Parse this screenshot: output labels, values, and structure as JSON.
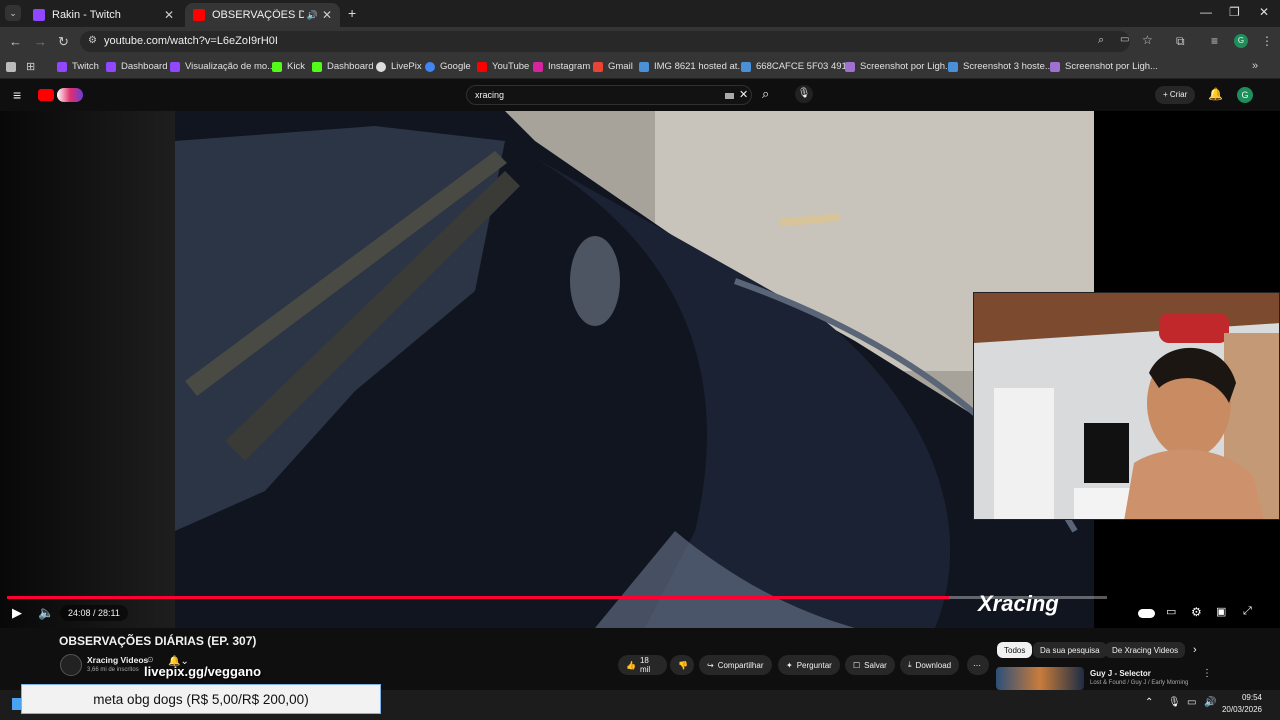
{
  "browser": {
    "tabs": [
      {
        "title": "Rakin - Twitch",
        "color": "#9146ff"
      },
      {
        "title": "OBSERVAÇÕES DIÁRIAS (EP",
        "color": "#ff0000"
      }
    ],
    "url": "youtube.com/watch?v=L6eZoI9rH0I",
    "bookmarks": [
      "Twitch",
      "Dashboard",
      "Visualização de mo...",
      "Kick",
      "Dashboard",
      "LivePix",
      "Google",
      "YouTube",
      "Instagram",
      "Gmail",
      "IMG 8621 hosted at...",
      "668CAFCE 5F03 491...",
      "Screenshot por Ligh...",
      "Screenshot 3 hoste...",
      "Screenshot por Ligh..."
    ]
  },
  "youtube": {
    "search_value": "xracing",
    "create_label": "Criar",
    "avatar_letter": "G"
  },
  "player": {
    "time": "24:08 / 28:11",
    "progress": 0.856,
    "watermark": "Xracing"
  },
  "video": {
    "title": "OBSERVAÇÕES DIÁRIAS (EP. 307)",
    "channel": "Xracing Videos",
    "subscribers": "3,66 mi de inscritos",
    "likes": "18 mil",
    "actions": {
      "share": "Compartilhar",
      "ask": "Perguntar",
      "save": "Salvar",
      "download": "Download"
    }
  },
  "sidebar": {
    "chips": [
      "Todos",
      "Da sua pesquisa",
      "De Xracing Videos"
    ],
    "rec_title": "Guy J - Selector",
    "rec_sub": "Lost & Found / Guy J / Early Morning"
  },
  "overlay": {
    "livepix": "livepix.gg/veggano",
    "meta": "meta obg dogs (R$ 5,00/R$ 200,00)"
  },
  "taskbar": {
    "time": "09:54",
    "date": "20/03/2026"
  }
}
